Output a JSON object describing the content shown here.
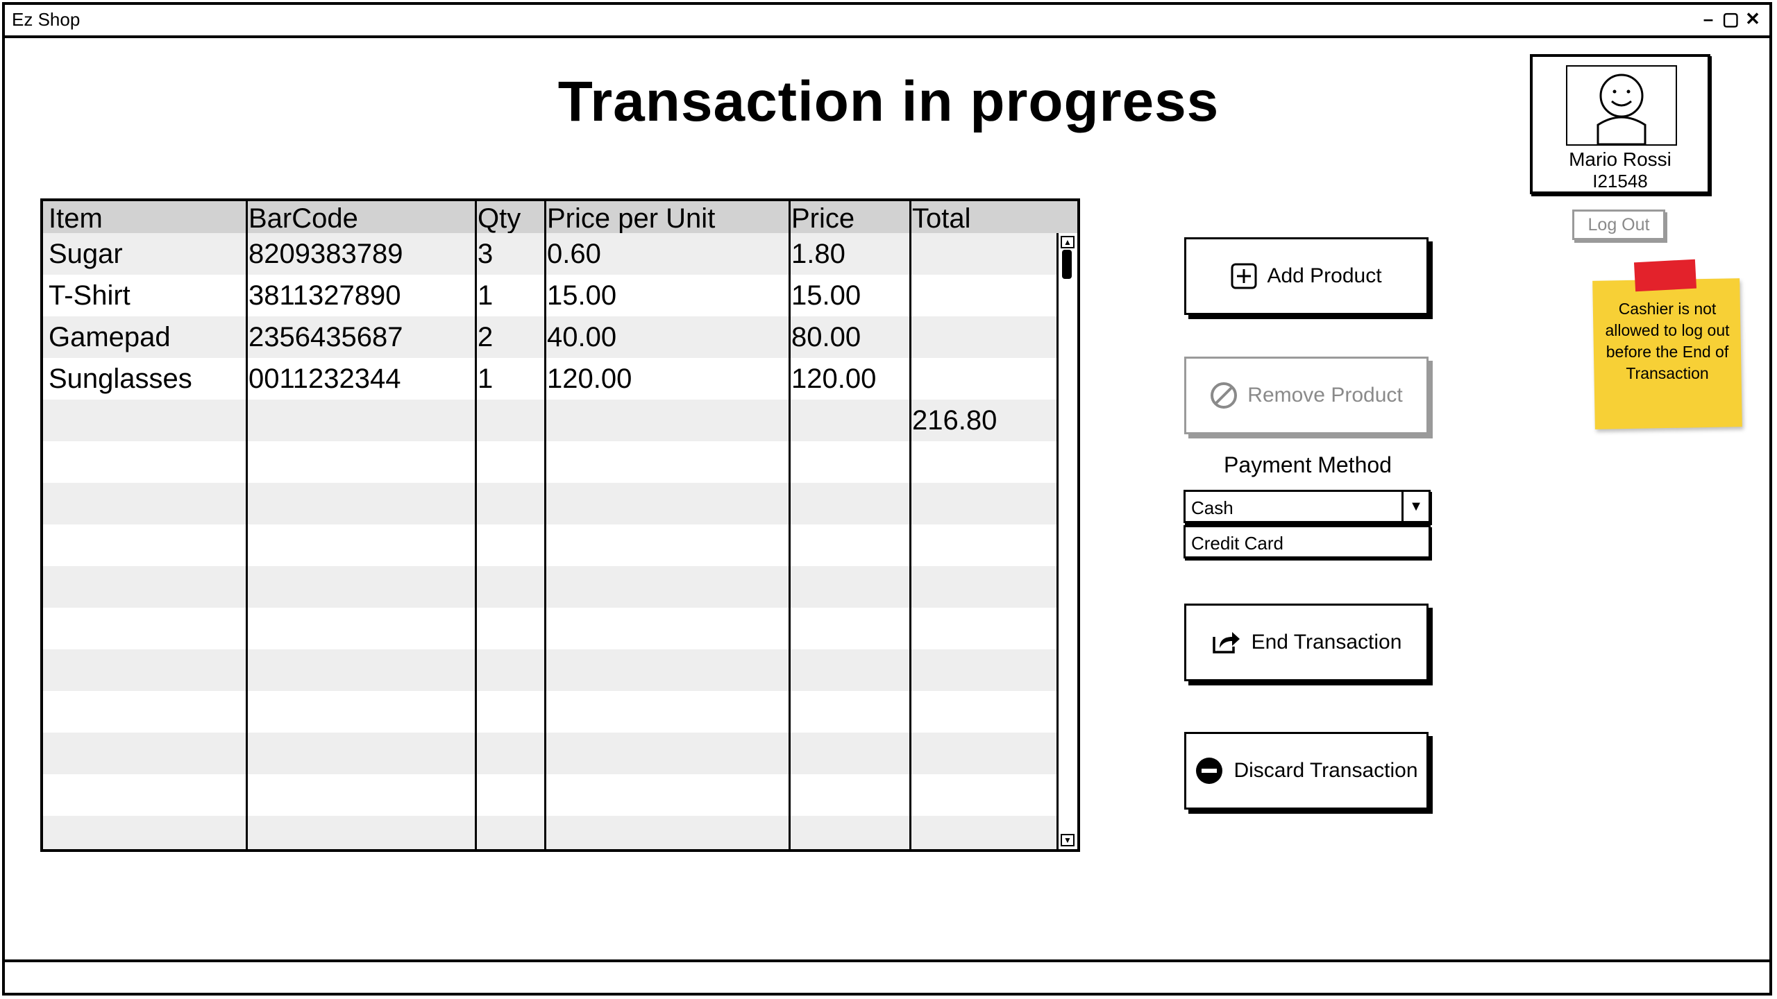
{
  "window": {
    "title": "Ez Shop",
    "controls": [
      "minimize-icon",
      "maximize-icon",
      "close-icon"
    ]
  },
  "page_title": "Transaction in progress",
  "table": {
    "columns": [
      "Item",
      "BarCode",
      "Qty",
      "Price per Unit",
      "Price",
      "Total"
    ],
    "rows": [
      {
        "item": "Sugar",
        "barcode": "8209383789",
        "qty": "3",
        "unit_price": "0.60",
        "price": "1.80",
        "total": ""
      },
      {
        "item": "T-Shirt",
        "barcode": "3811327890",
        "qty": "1",
        "unit_price": "15.00",
        "price": "15.00",
        "total": ""
      },
      {
        "item": "Gamepad",
        "barcode": "2356435687",
        "qty": "2",
        "unit_price": "40.00",
        "price": "80.00",
        "total": ""
      },
      {
        "item": "Sunglasses",
        "barcode": "0011232344",
        "qty": "1",
        "unit_price": "120.00",
        "price": "120.00",
        "total": ""
      },
      {
        "item": "",
        "barcode": "",
        "qty": "",
        "unit_price": "",
        "price": "",
        "total": "216.80"
      }
    ],
    "empty_rows": 10
  },
  "actions": {
    "add_product": "Add Product",
    "remove_product": "Remove Product",
    "end_transaction": "End Transaction",
    "discard_transaction": "Discard Transaction"
  },
  "payment": {
    "label": "Payment Method",
    "selected": "Cash",
    "options": [
      "Credit Card"
    ]
  },
  "user": {
    "name": "Mario Rossi",
    "id": "I21548",
    "logout_label": "Log Out"
  },
  "note": {
    "text": "Cashier is not allowed to log out before the End of Transaction"
  },
  "colors": {
    "header_bg": "#d2d2d2",
    "row_alt_bg": "#eeeeee",
    "disabled": "#9a9a9a",
    "note_bg": "#f7d036",
    "note_tape": "#e3222b"
  }
}
